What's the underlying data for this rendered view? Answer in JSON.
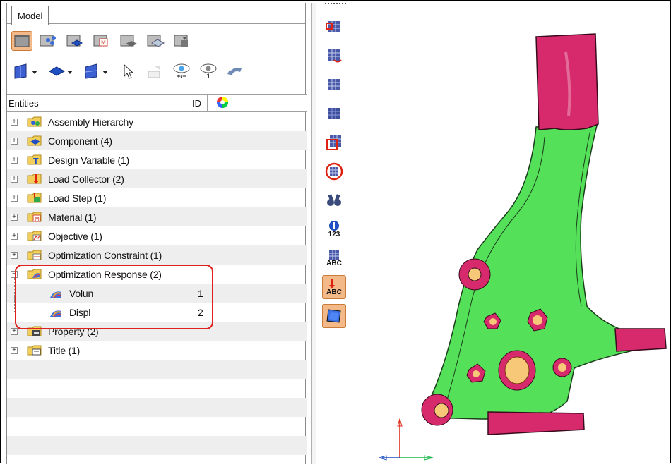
{
  "panel": {
    "tab": "Model",
    "entities_header": "Entities",
    "id_header": "ID"
  },
  "toolbar1_icons": [
    "component-view-icon",
    "assembly-view-icon",
    "part-view-icon",
    "material-view-icon",
    "load-view-icon",
    "property-view-icon",
    "element-view-icon"
  ],
  "toolbar2_icons": [
    "element-color-icon",
    "component-mode-icon",
    "mesh-mode-icon",
    "select-arrow-icon",
    "export-icon",
    "show-hide-icon",
    "isolate-icon",
    "undo-icon"
  ],
  "toolbar2_small": {
    "show_hide": "+/−",
    "isolate": "1"
  },
  "tree": [
    {
      "label": "Assembly Hierarchy",
      "icon": "assembly-icon"
    },
    {
      "label": "Component (4)",
      "icon": "component-icon"
    },
    {
      "label": "Design Variable (1)",
      "icon": "design-variable-icon"
    },
    {
      "label": "Load Collector (2)",
      "icon": "load-collector-icon"
    },
    {
      "label": "Load Step (1)",
      "icon": "load-step-icon"
    },
    {
      "label": "Material (1)",
      "icon": "material-icon"
    },
    {
      "label": "Objective (1)",
      "icon": "objective-icon"
    },
    {
      "label": "Optimization Constraint (1)",
      "icon": "constraint-icon"
    },
    {
      "label": "Optimization Response (2)",
      "icon": "response-icon",
      "expanded": true
    },
    {
      "label": "Property (2)",
      "icon": "property-icon"
    },
    {
      "label": "Title (1)",
      "icon": "title-icon"
    }
  ],
  "children": [
    {
      "label": "Volun",
      "id": "1"
    },
    {
      "label": "Displ",
      "id": "2"
    }
  ],
  "vtoolbar": {
    "labels": {
      "count": "123",
      "abc": "ABC",
      "abc2": "ABC"
    }
  },
  "colors": {
    "model_green": "#55e05a",
    "model_magenta": "#d62a6c",
    "highlight_red": "#e0201e",
    "selected_orange": "#f3b989"
  }
}
